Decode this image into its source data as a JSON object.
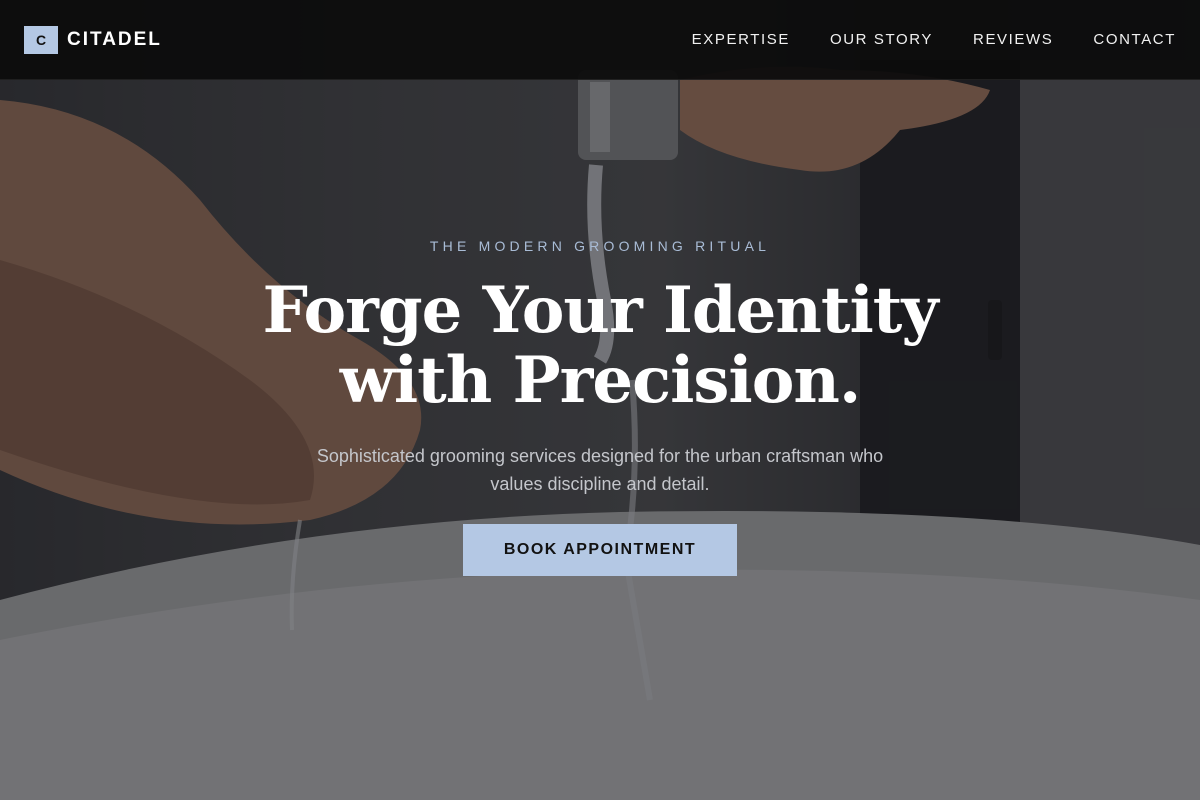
{
  "brand": {
    "mark": "C",
    "name": "CITADEL"
  },
  "nav": {
    "items": [
      {
        "label": "EXPERTISE"
      },
      {
        "label": "OUR STORY"
      },
      {
        "label": "REVIEWS"
      },
      {
        "label": "CONTACT"
      }
    ]
  },
  "hero": {
    "eyebrow": "THE MODERN GROOMING RITUAL",
    "headline_line1": "Forge Your Identity",
    "headline_line2": "with Precision.",
    "subtext": "Sophisticated grooming services designed for the urban craftsman who values discipline and detail.",
    "cta_label": "BOOK APPOINTMENT"
  },
  "colors": {
    "accent": "#b4c8e4",
    "navbar_bg": "#0c0c0c",
    "eyebrow": "#a9bcd6",
    "subtext": "#c4c6cb"
  }
}
